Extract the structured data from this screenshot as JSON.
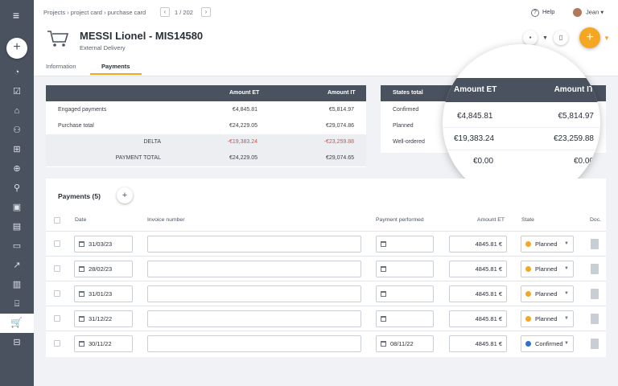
{
  "sidebar": {
    "menu_icon": "menu-icon",
    "add_icon": "plus-icon",
    "active_item": "cart-icon"
  },
  "header": {
    "breadcrumb": [
      "Projects",
      "project card",
      "purchase card"
    ],
    "pager": "1 / 202",
    "help_label": "Help",
    "user_name": "Jean",
    "title": "MESSI Lionel - MIS14580",
    "subtitle": "External Delivery",
    "tabs": [
      {
        "label": "Information"
      },
      {
        "label": "Payments"
      }
    ]
  },
  "summary": {
    "headers": {
      "et": "Amount ET",
      "it": "Amount IT"
    },
    "rows": [
      {
        "label": "Engaged payments",
        "et": "€4,845.81",
        "it": "€5,814.97"
      },
      {
        "label": "Purchase total",
        "et": "€24,229.05",
        "it": "€29,074.86"
      },
      {
        "label": "DELTA",
        "et": "-€19,383.24",
        "it": "-€23,259.88"
      },
      {
        "label": "PAYMENT TOTAL",
        "et": "€24,229.05",
        "it": "€29,074.65"
      }
    ]
  },
  "states": {
    "title": "States total",
    "rows": [
      {
        "label": "Confirmed"
      },
      {
        "label": "Planned"
      },
      {
        "label": "Well-ordered"
      }
    ]
  },
  "magnifier": {
    "headers": {
      "et": "Amount ET",
      "it": "Amount IT"
    },
    "rows": [
      {
        "et": "€4,845.81",
        "it": "€5,814.97"
      },
      {
        "et": "€19,383.24",
        "it": "€23,259.88"
      },
      {
        "et": "€0.00",
        "it": "€0.00"
      }
    ]
  },
  "payments": {
    "title": "Payments (5)",
    "columns": {
      "date": "Date",
      "invoice": "Invoice number",
      "performed": "Payment performed",
      "amount": "Amount ET",
      "state": "State",
      "doc": "Doc."
    },
    "rows": [
      {
        "date": "31/03/23",
        "invoice": "",
        "performed": "",
        "amount": "4845.81 €",
        "state": "Planned"
      },
      {
        "date": "28/02/23",
        "invoice": "",
        "performed": "",
        "amount": "4845.81 €",
        "state": "Planned"
      },
      {
        "date": "31/01/23",
        "invoice": "",
        "performed": "",
        "amount": "4845.81 €",
        "state": "Planned"
      },
      {
        "date": "31/12/22",
        "invoice": "",
        "performed": "",
        "amount": "4845.81 €",
        "state": "Planned"
      },
      {
        "date": "30/11/22",
        "invoice": "",
        "performed": "08/11/22",
        "amount": "4845.81 €",
        "state": "Confirmed"
      }
    ]
  },
  "colors": {
    "accent": "#f5a623",
    "sidebar": "#4a5260",
    "delta": "#e34a3f",
    "planned": "#f5a623",
    "confirmed": "#2d6fd6"
  }
}
